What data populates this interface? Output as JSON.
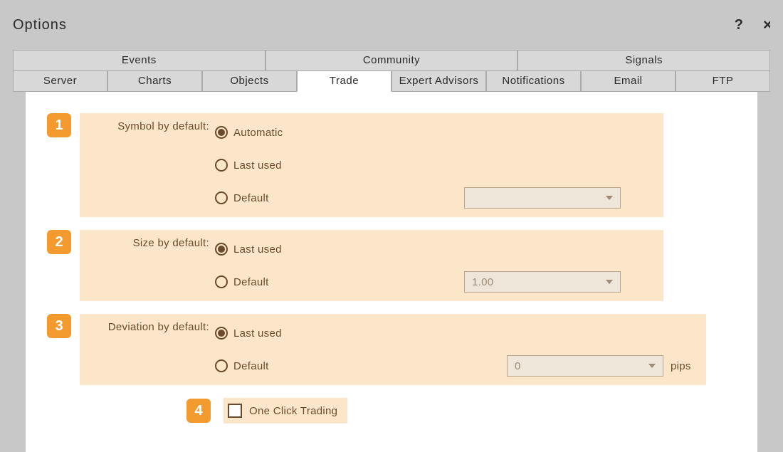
{
  "window": {
    "title": "Options",
    "help": "?",
    "close": ">"
  },
  "tabs_top": [
    {
      "label": "Events"
    },
    {
      "label": "Community"
    },
    {
      "label": "Signals"
    }
  ],
  "tabs_bot": [
    {
      "label": "Server"
    },
    {
      "label": "Charts"
    },
    {
      "label": "Objects"
    },
    {
      "label": "Trade",
      "active": true
    },
    {
      "label": "Expert Advisors"
    },
    {
      "label": "Notifications"
    },
    {
      "label": "Email"
    },
    {
      "label": "FTP"
    }
  ],
  "badges": {
    "b1": "1",
    "b2": "2",
    "b3": "3",
    "b4": "4"
  },
  "symbol": {
    "label": "Symbol by default:",
    "opt_automatic": "Automatic",
    "opt_last": "Last used",
    "opt_default": "Default",
    "combo_value": ""
  },
  "size": {
    "label": "Size by default:",
    "opt_last": "Last used",
    "opt_default": "Default",
    "combo_value": "1.00"
  },
  "deviation": {
    "label": "Deviation by default:",
    "opt_last": "Last used",
    "opt_default": "Default",
    "combo_value": "0",
    "suffix": "pips"
  },
  "oct": {
    "label": "One Click Trading"
  }
}
